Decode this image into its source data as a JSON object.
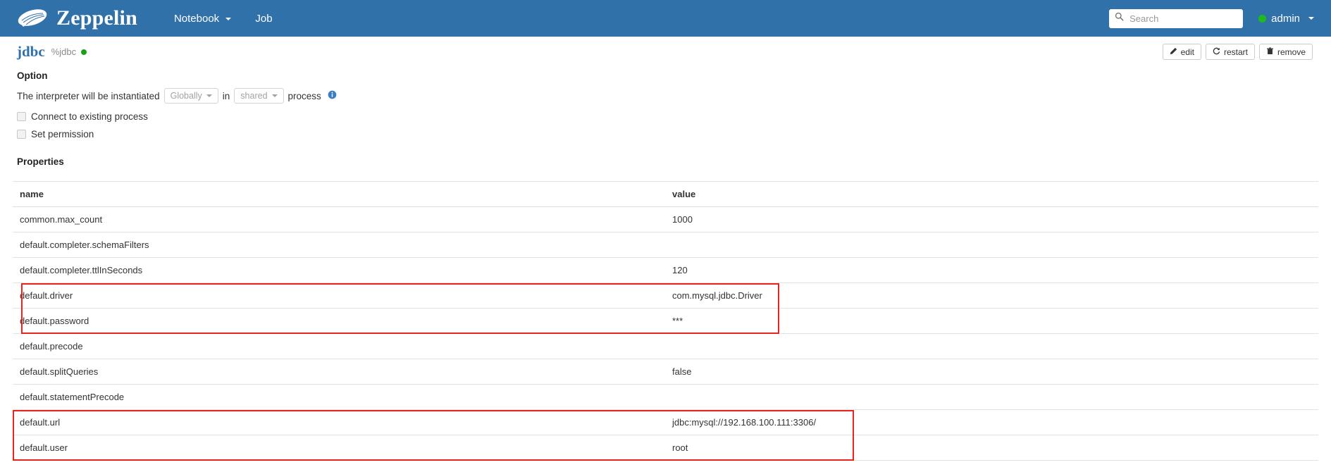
{
  "navbar": {
    "brand": "Zeppelin",
    "logo_icon": "zeppelin-airship-logo",
    "links": [
      {
        "label": "Notebook",
        "has_caret": true
      },
      {
        "label": "Job",
        "has_caret": false
      }
    ],
    "search": {
      "placeholder": "Search",
      "value": "",
      "icon": "search-icon"
    },
    "user": {
      "label": "admin",
      "status": "online",
      "status_color": "#1ebb1e"
    },
    "background_color": "#3071a9"
  },
  "interpreter": {
    "name": "jdbc",
    "magic": "%jdbc",
    "status_color": "#17a117",
    "actions": [
      {
        "label": "edit",
        "icon": "pencil-icon"
      },
      {
        "label": "restart",
        "icon": "refresh-icon"
      },
      {
        "label": "remove",
        "icon": "trash-icon"
      }
    ]
  },
  "option": {
    "title": "Option",
    "sentence_start": "The interpreter will be instantiated",
    "scope_value": "Globally",
    "sentence_middle": "in",
    "process_value": "shared",
    "sentence_end": "process",
    "info_icon": "info-circle-icon",
    "checkboxes": [
      {
        "label": "Connect to existing process",
        "checked": false
      },
      {
        "label": "Set permission",
        "checked": false
      }
    ]
  },
  "properties": {
    "title": "Properties",
    "columns": [
      "name",
      "value"
    ],
    "rows": [
      {
        "name": "common.max_count",
        "value": "1000"
      },
      {
        "name": "default.completer.schemaFilters",
        "value": ""
      },
      {
        "name": "default.completer.ttlInSeconds",
        "value": "120"
      },
      {
        "name": "default.driver",
        "value": "com.mysql.jdbc.Driver"
      },
      {
        "name": "default.password",
        "value": "***"
      },
      {
        "name": "default.precode",
        "value": ""
      },
      {
        "name": "default.splitQueries",
        "value": "false"
      },
      {
        "name": "default.statementPrecode",
        "value": ""
      },
      {
        "name": "default.url",
        "value": "jdbc:mysql://192.168.100.111:3306/"
      },
      {
        "name": "default.user",
        "value": "root"
      }
    ]
  },
  "annotations": {
    "color": "#e8231f",
    "boxes": [
      {
        "name": "driver-password-highlight",
        "rows": [
          "default.driver",
          "default.password"
        ]
      },
      {
        "name": "url-user-highlight",
        "rows": [
          "default.url",
          "default.user"
        ]
      }
    ]
  }
}
